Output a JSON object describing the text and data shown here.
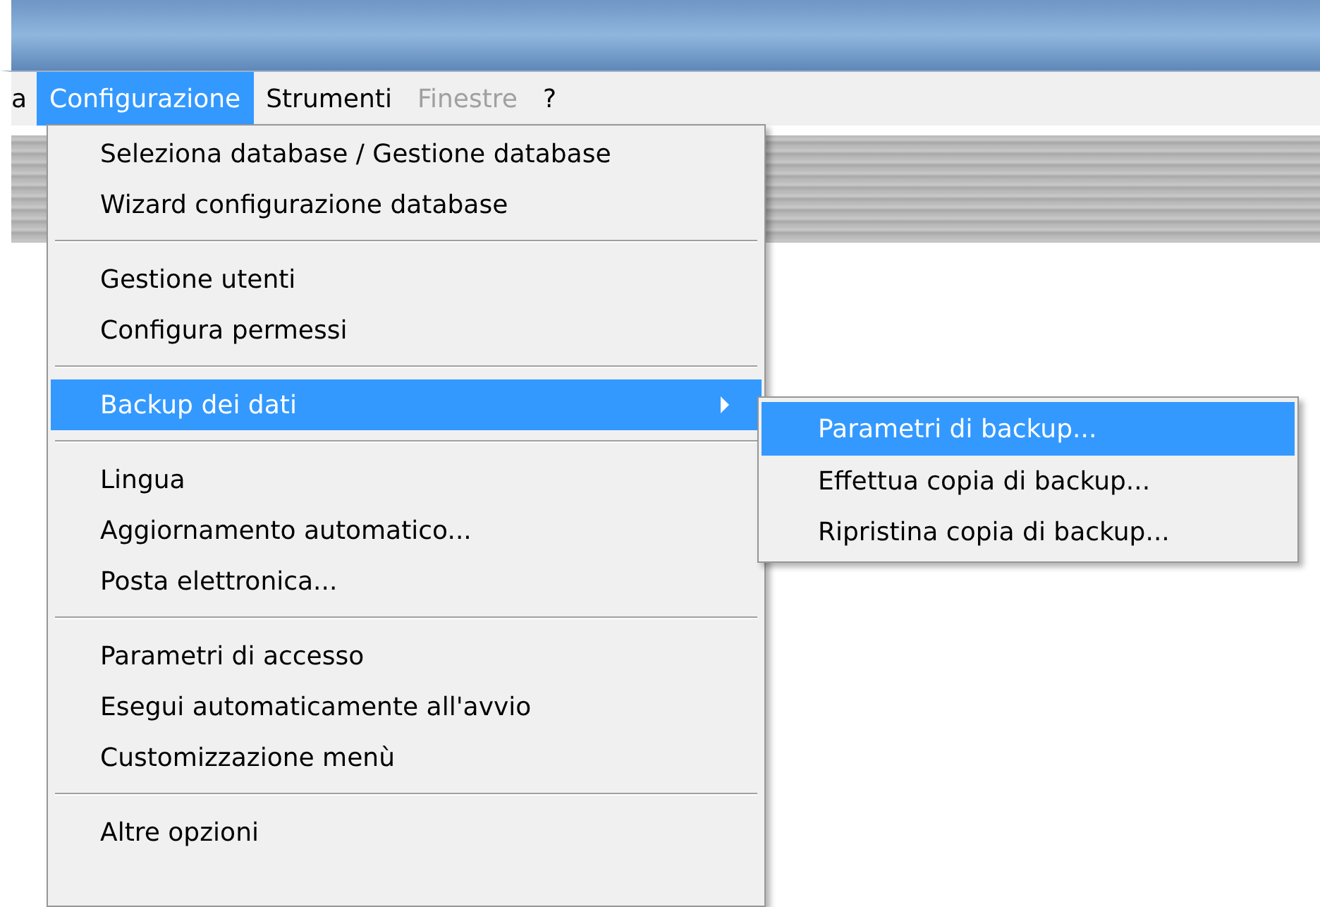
{
  "menu_bar": [
    {
      "label": "a",
      "selected": false,
      "disabled": false
    },
    {
      "label": "Configurazione",
      "selected": true,
      "disabled": false
    },
    {
      "label": "Strumenti",
      "selected": false,
      "disabled": false
    },
    {
      "label": "Finestre",
      "selected": false,
      "disabled": true
    },
    {
      "label": "?",
      "selected": false,
      "disabled": false
    }
  ],
  "menu": [
    {
      "kind": "item",
      "label": "Seleziona database / Gestione database",
      "selected": false,
      "submenu": false
    },
    {
      "kind": "item",
      "label": "Wizard configurazione database",
      "selected": false,
      "submenu": false
    },
    {
      "kind": "separator"
    },
    {
      "kind": "item",
      "label": "Gestione utenti",
      "selected": false,
      "submenu": false
    },
    {
      "kind": "item",
      "label": "Configura permessi",
      "selected": false,
      "submenu": false
    },
    {
      "kind": "separator"
    },
    {
      "kind": "item",
      "label": "Backup dei dati",
      "selected": true,
      "submenu": true
    },
    {
      "kind": "separator"
    },
    {
      "kind": "item",
      "label": "Lingua",
      "selected": false,
      "submenu": false
    },
    {
      "kind": "item",
      "label": "Aggiornamento automatico...",
      "selected": false,
      "submenu": false
    },
    {
      "kind": "item",
      "label": "Posta elettronica...",
      "selected": false,
      "submenu": false
    },
    {
      "kind": "separator"
    },
    {
      "kind": "item",
      "label": "Parametri di accesso",
      "selected": false,
      "submenu": false
    },
    {
      "kind": "item",
      "label": "Esegui automaticamente all'avvio",
      "selected": false,
      "submenu": false
    },
    {
      "kind": "item",
      "label": "Customizzazione menù",
      "selected": false,
      "submenu": false
    },
    {
      "kind": "separator"
    },
    {
      "kind": "item",
      "label": "Altre opzioni",
      "selected": false,
      "submenu": false
    }
  ],
  "submenu": [
    {
      "label": "Parametri di backup...",
      "selected": true
    },
    {
      "label": "Effettua copia di backup...",
      "selected": false
    },
    {
      "label": "Ripristina copia di backup...",
      "selected": false
    }
  ]
}
